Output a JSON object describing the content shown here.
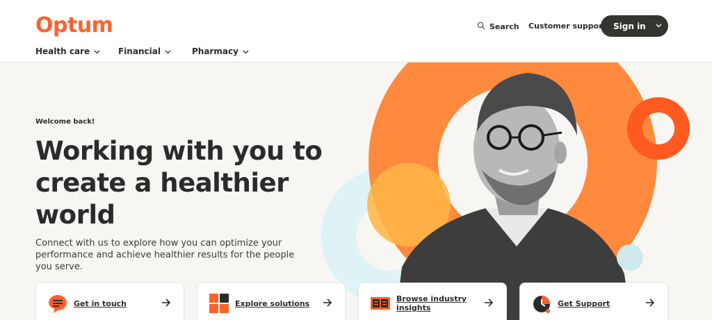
{
  "header": {
    "logo": "Optum",
    "search_label": "Search",
    "support_label": "Customer support",
    "signin_label": "Sign in",
    "nav": [
      "Health care",
      "Financial",
      "Pharmacy"
    ]
  },
  "hero": {
    "welcome": "Welcome back!",
    "headline": "Working with you to create a healthier world",
    "subtext": "Connect with us to explore how you can optimize your performance and achieve healthier results for the people you serve."
  },
  "cards": [
    {
      "label": "Get in touch",
      "icon": "chat-bubble-icon"
    },
    {
      "label": "Explore solutions",
      "icon": "grid-squares-icon"
    },
    {
      "label": "Browse industry insights",
      "icon": "newspaper-icon"
    },
    {
      "label": "Get Support",
      "icon": "support-clock-icon"
    }
  ],
  "colors": {
    "brand": "#ff612b",
    "dark": "#353431",
    "ring_orange": "#ff8a3d",
    "accent_yellow": "#ffb545",
    "light_teal": "#dff3f6"
  }
}
